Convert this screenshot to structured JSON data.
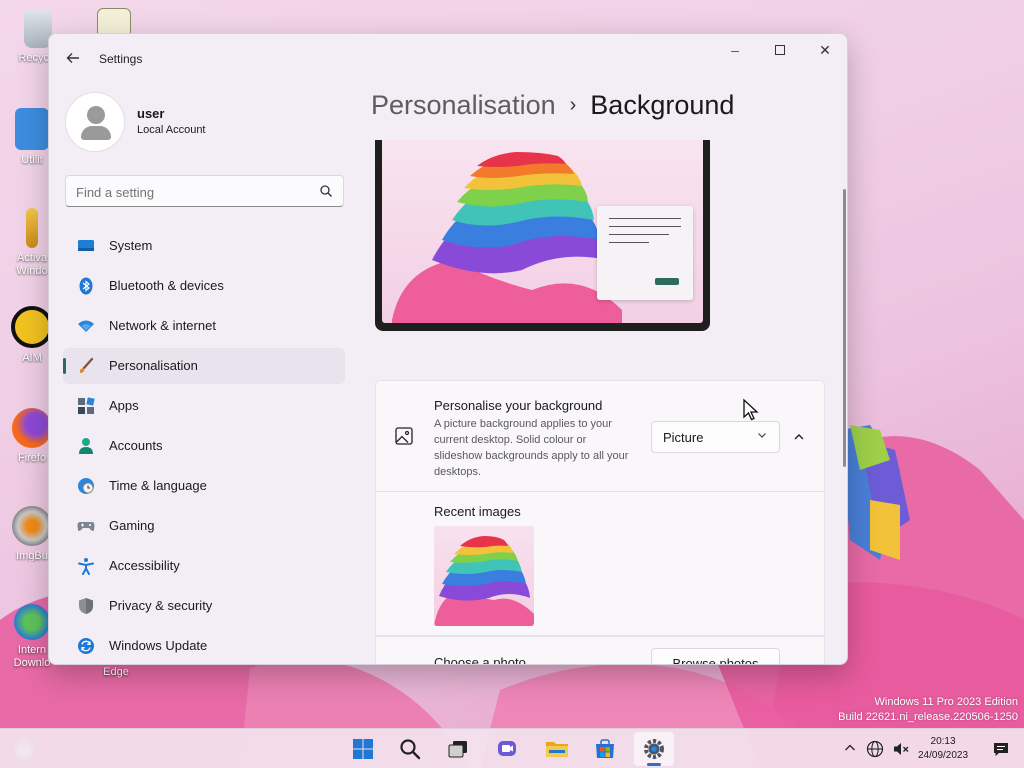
{
  "desktop": {
    "icons": [
      {
        "label": "Recycle"
      },
      {
        "label": "Utilit"
      },
      {
        "label": "Activa Windo"
      },
      {
        "label": "AIM"
      },
      {
        "label": "Firefo"
      },
      {
        "label": "ImgBu"
      },
      {
        "label": "Intern Downlo"
      },
      {
        "label": "Edge"
      }
    ],
    "watermark": {
      "line1": "Windows 11 Pro 2023 Edition",
      "line2": "Build 22621.ni_release.220506-1250"
    }
  },
  "window": {
    "title": "Settings",
    "back_icon": "arrow-left-icon",
    "controls": {
      "minimize": "─",
      "maximize": "☐",
      "close": "✕"
    }
  },
  "profile": {
    "name": "user",
    "account_type": "Local Account"
  },
  "search": {
    "placeholder": "Find a setting",
    "icon": "search-icon"
  },
  "sidebar": {
    "items": [
      {
        "label": "System",
        "icon": "monitor-icon"
      },
      {
        "label": "Bluetooth & devices",
        "icon": "bluetooth-icon"
      },
      {
        "label": "Network & internet",
        "icon": "wifi-icon"
      },
      {
        "label": "Personalisation",
        "icon": "brush-icon",
        "active": true
      },
      {
        "label": "Apps",
        "icon": "apps-icon"
      },
      {
        "label": "Accounts",
        "icon": "person-icon"
      },
      {
        "label": "Time & language",
        "icon": "globe-clock-icon"
      },
      {
        "label": "Gaming",
        "icon": "controller-icon"
      },
      {
        "label": "Accessibility",
        "icon": "accessibility-icon"
      },
      {
        "label": "Privacy & security",
        "icon": "shield-icon"
      },
      {
        "label": "Windows Update",
        "icon": "update-icon"
      }
    ]
  },
  "breadcrumb": {
    "parent": "Personalisation",
    "separator": "›",
    "current": "Background"
  },
  "background": {
    "personalise": {
      "title": "Personalise your background",
      "description": "A picture background applies to your current desktop. Solid colour or slideshow backgrounds apply to all your desktops.",
      "selected": "Picture",
      "chevron_down": "⌄",
      "collapse": "⌃"
    },
    "recent_images_title": "Recent images",
    "choose_photo": {
      "label": "Choose a photo",
      "button": "Browse photos"
    }
  },
  "taskbar": {
    "pinned": [
      "start-icon",
      "search-icon",
      "task-view-icon",
      "chat-icon",
      "file-explorer-icon",
      "store-icon",
      "settings-icon"
    ],
    "active": "settings-icon",
    "clock": {
      "time": "20:13",
      "date": "24/09/2023"
    }
  },
  "colors": {
    "accent": "#2a6b5a",
    "window_bg": "#f3eef6",
    "card_bg": "#f9f7fa"
  }
}
